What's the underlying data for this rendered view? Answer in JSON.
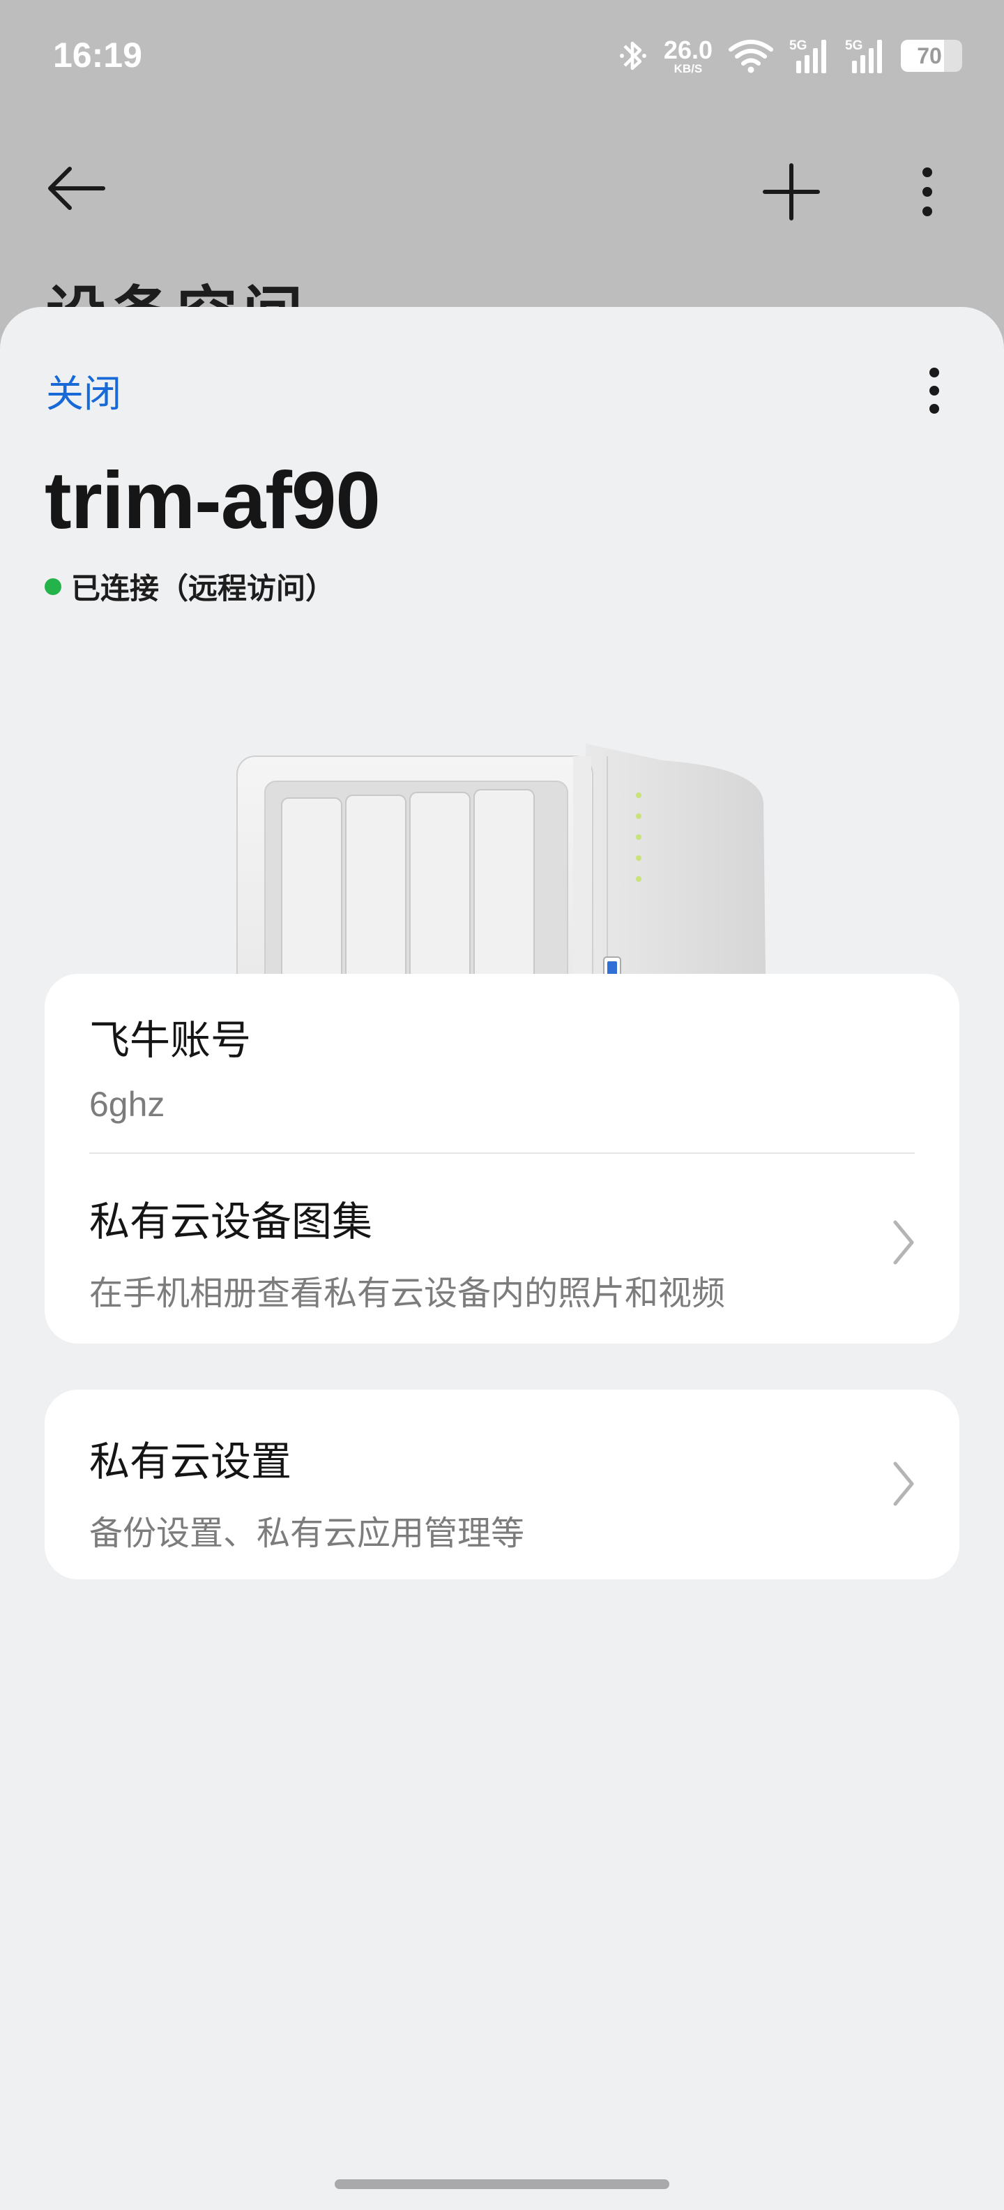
{
  "status_bar": {
    "time": "16:19",
    "net_speed_value": "26.0",
    "net_speed_unit": "KB/S",
    "signal_1_tag": "5G",
    "signal_2_tag": "5G",
    "battery_percent": "70",
    "battery_level": 0.7,
    "icons": [
      "bluetooth-icon",
      "wifi-icon",
      "signal-icon",
      "signal-icon",
      "battery-icon"
    ]
  },
  "background_screen": {
    "title_partial": "设备空间",
    "icons": [
      "back-arrow-icon",
      "plus-icon",
      "more-vertical-icon"
    ]
  },
  "sheet": {
    "close_label": "关闭",
    "device_name": "trim-af90",
    "connection_status": "已连接（远程访问）",
    "status_color": "#24b24b",
    "accent_color": "#1669d6"
  },
  "cards": {
    "account": {
      "title": "飞牛账号",
      "value": "6ghz"
    },
    "gallery": {
      "title": "私有云设备图集",
      "subtitle": "在手机相册查看私有云设备内的照片和视频"
    },
    "settings": {
      "title": "私有云设置",
      "subtitle": "备份设置、私有云应用管理等"
    }
  }
}
